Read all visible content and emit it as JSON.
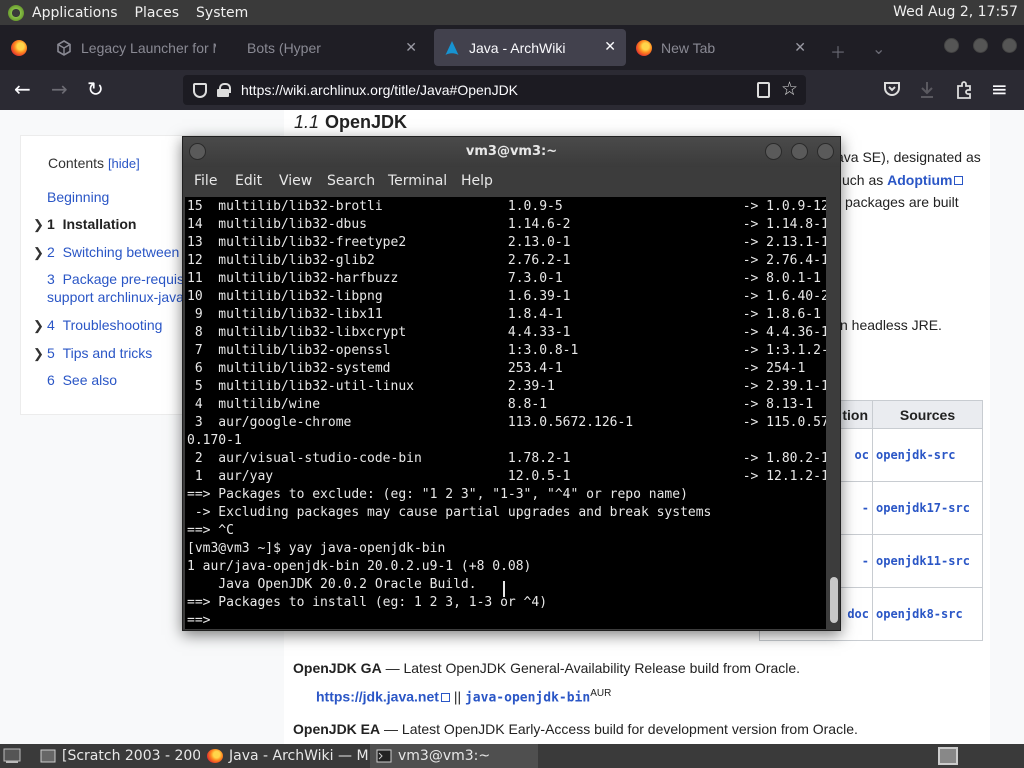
{
  "top_panel": {
    "menus": [
      "Applications",
      "Places",
      "System"
    ],
    "clock": "Wed Aug  2, 17:57"
  },
  "browser": {
    "tabs": [
      {
        "title": "Legacy Launcher for M",
        "icon": "cube-icon"
      },
      {
        "title": "Bots (Hyper",
        "icon": "none"
      },
      {
        "title": "Java - ArchWiki",
        "icon": "archlinux-icon",
        "active": true
      },
      {
        "title": "New Tab",
        "icon": "firefox-icon"
      }
    ],
    "url": "https://wiki.archlinux.org/title/Java#OpenJDK"
  },
  "page": {
    "toc": {
      "title": "Contents",
      "hide": "[hide]",
      "items": [
        {
          "text": "Beginning"
        },
        {
          "num": "1",
          "text": "Installation"
        },
        {
          "num": "2",
          "text": "Switching between"
        },
        {
          "num": "3",
          "text": "Package pre-requis"
        },
        {
          "text": "support archlinux-java"
        },
        {
          "num": "4",
          "text": "Troubleshooting"
        },
        {
          "num": "5",
          "text": "Tips and tricks"
        },
        {
          "num": "6",
          "text": "See also"
        }
      ]
    },
    "heading": {
      "number": "1.1",
      "title": "OpenJDK"
    },
    "para_fragments": {
      "line1": "ava SE), designated as",
      "line2_pre": "uch as ",
      "line2_link": "Adoptium",
      "line3": "packages are built",
      "line4": "n headless JRE."
    },
    "table": {
      "headers": [
        "tion",
        "Sources"
      ],
      "rows": [
        {
          "a": "oc",
          "b": "openjdk-src"
        },
        {
          "a": "-",
          "b": "openjdk17-src"
        },
        {
          "a": "-",
          "b": "openjdk11-src"
        },
        {
          "a": "doc",
          "b": "openjdk8-src"
        }
      ]
    },
    "ga": {
      "label": "OpenJDK GA",
      "desc": " — Latest OpenJDK General-Availability Release build from Oracle.",
      "link": "https://jdk.java.net",
      "sep": "||",
      "pkg": "java-openjdk-bin",
      "sup": "AUR"
    },
    "ea": {
      "label": "OpenJDK EA",
      "desc": " — Latest OpenJDK Early-Access build for development version from Oracle."
    }
  },
  "terminal": {
    "title": "vm3@vm3:~",
    "menu": [
      "File",
      "Edit",
      "View",
      "Search",
      "Terminal",
      "Help"
    ],
    "lines": [
      "15  multilib/lib32-brotli                1.0.9-5                       -> 1.0.9-12",
      "14  multilib/lib32-dbus                  1.14.6-2                      -> 1.14.8-1",
      "13  multilib/lib32-freetype2             2.13.0-1                      -> 2.13.1-1",
      "12  multilib/lib32-glib2                 2.76.2-1                      -> 2.76.4-1",
      "11  multilib/lib32-harfbuzz              7.3.0-1                       -> 8.0.1-1",
      "10  multilib/lib32-libpng                1.6.39-1                      -> 1.6.40-2",
      " 9  multilib/lib32-libx11                1.8.4-1                       -> 1.8.6-1",
      " 8  multilib/lib32-libxcrypt             4.4.33-1                      -> 4.4.36-1",
      " 7  multilib/lib32-openssl               1:3.0.8-1                     -> 1:3.1.2-1",
      " 6  multilib/lib32-systemd               253.4-1                       -> 254-1",
      " 5  multilib/lib32-util-linux            2.39-1                        -> 2.39.1-1",
      " 4  multilib/wine                        8.8-1                         -> 8.13-1",
      " 3  aur/google-chrome                    113.0.5672.126-1              -> 115.0.579",
      "0.170-1",
      " 2  aur/visual-studio-code-bin           1.78.2-1                      -> 1.80.2-1",
      " 1  aur/yay                              12.0.5-1                      -> 12.1.2-1",
      "==> Packages to exclude: (eg: \"1 2 3\", \"1-3\", \"^4\" or repo name)",
      " -> Excluding packages may cause partial upgrades and break systems",
      "==> ^C",
      "[vm3@vm3 ~]$ yay java-openjdk-bin",
      "1 aur/java-openjdk-bin 20.0.2.u9-1 (+8 0.08)",
      "    Java OpenJDK 20.0.2 Oracle Build.",
      "==> Packages to install (eg: 1 2 3, 1-3 or ^4)",
      "==> "
    ]
  },
  "taskbar": {
    "items": [
      {
        "label": "[Scratch 2003 - 200...",
        "icon": "window-icon"
      },
      {
        "label": "Java - ArchWiki — M...",
        "icon": "firefox-icon"
      },
      {
        "label": "vm3@vm3:~",
        "icon": "terminal-icon",
        "active": true
      }
    ]
  },
  "colors": {
    "link": "#2a56c6",
    "terminal_bg": "#000000",
    "terminal_fg": "#e8e8e8",
    "panel": "#3a3a3a",
    "tabbar": "#1f1e25"
  }
}
